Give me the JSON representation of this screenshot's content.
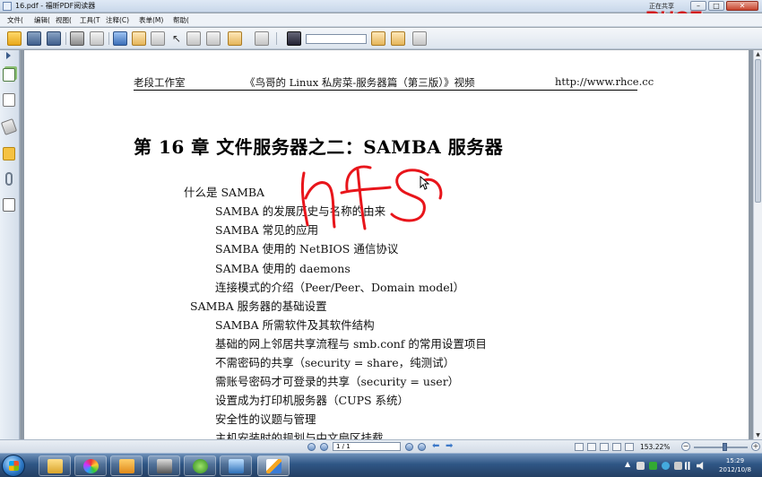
{
  "window": {
    "title": "16.pdf - 福昕PDF阅读器",
    "share_label": "正在共享",
    "minimize": "–",
    "maximize": "□",
    "close": "✕"
  },
  "watermark": "RHCE.cc",
  "menu": [
    "文件(",
    "编辑(",
    "视图(",
    "工具(T",
    "注释(C)",
    "表单(M)",
    "帮助("
  ],
  "toolbar": {
    "search_value": "",
    "icons": [
      "open-folder-icon",
      "save-icon",
      "save-as-icon",
      "print-icon",
      "fullscreen-icon",
      "hand-tool-icon",
      "zoom-tool-icon",
      "select-arrow-icon",
      "text-select-icon",
      "snapshot-icon",
      "stamp-icon",
      "typewriter-icon",
      "find-icon",
      "find-prev-icon",
      "find-next-icon",
      "highlight-icon"
    ]
  },
  "document": {
    "header_left": "老段工作室",
    "header_center": "《鸟哥的 Linux 私房菜-服务器篇（第三版）》视频",
    "header_right": "http://www.rhce.cc",
    "chapter_title": "第 16 章  文件服务器之二：SAMBA 服务器",
    "toc": [
      {
        "text": "什么是  SAMBA",
        "level": 1
      },
      {
        "text": "SAMBA  的发展历史与名称的由来",
        "level": 2
      },
      {
        "text": "SAMBA  常见的应用",
        "level": 2
      },
      {
        "text": "SAMBA  使用的  NetBIOS  通信协议",
        "level": 2
      },
      {
        "text": "SAMBA  使用的  daemons",
        "level": 2
      },
      {
        "text": "连接模式的介绍（Peer/Peer、Domain model）",
        "level": 2
      },
      {
        "text": "SAMBA  服务器的基础设置",
        "level": 1
      },
      {
        "text": "SAMBA 所需软件及其软件结构",
        "level": 2
      },
      {
        "text": "基础的网上邻居共享流程与  smb.conf  的常用设置项目",
        "level": 2
      },
      {
        "text": "不需密码的共享（security = share，纯测试）",
        "level": 2
      },
      {
        "text": "需账号密码才可登录的共享（security = user）",
        "level": 2
      },
      {
        "text": "设置成为打印机服务器（CUPS  系统）",
        "level": 2
      },
      {
        "text": "安全性的议题与管理",
        "level": 2
      },
      {
        "text": "主机安装时的规划与中文扇区挂载",
        "level": 2
      }
    ],
    "annotation_color": "#e8151b"
  },
  "statusbar": {
    "page_display": "1 / 1",
    "zoom": "153.22%"
  },
  "taskbar": {
    "clock_time": "15:29",
    "clock_date": "2012/10/8"
  }
}
